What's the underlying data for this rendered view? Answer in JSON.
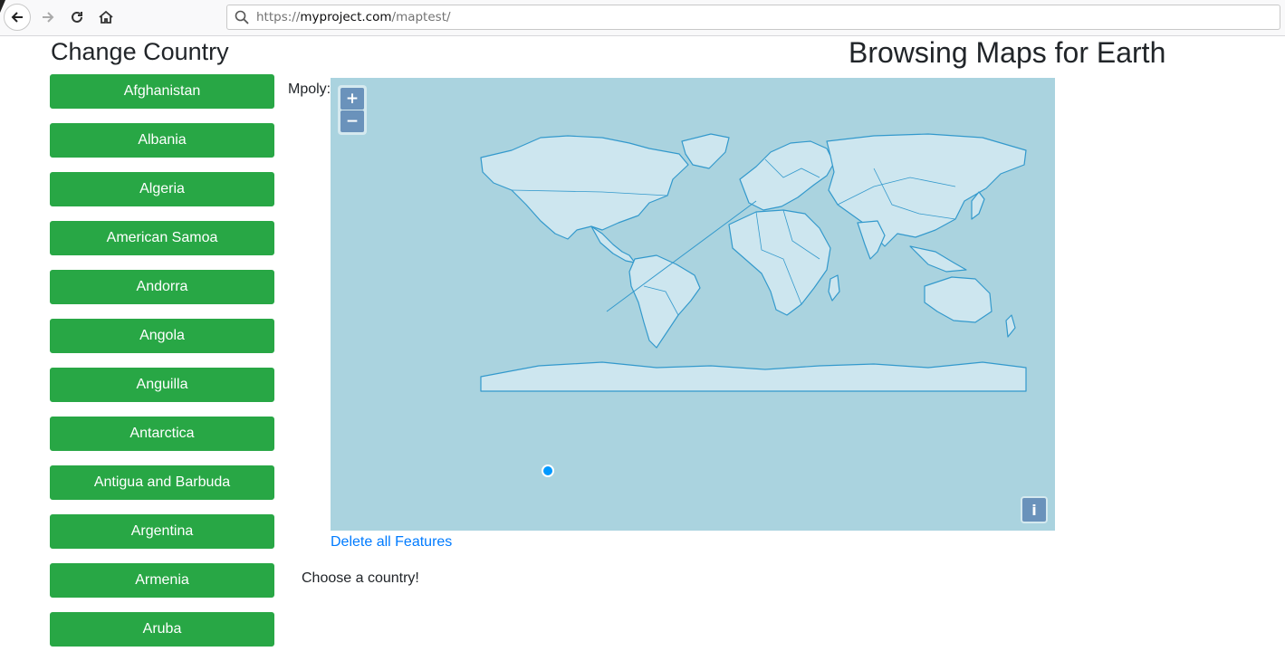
{
  "browser": {
    "url_scheme": "https://",
    "url_host": "myproject.com",
    "url_path": "/maptest/"
  },
  "page": {
    "left_title": "Change Country",
    "right_title": "Browsing Maps for Earth",
    "mpoly_label": "Mpoly:",
    "delete_link": "Delete all Features",
    "status_text": "Choose a country!"
  },
  "countries": [
    "Afghanistan",
    "Albania",
    "Algeria",
    "American Samoa",
    "Andorra",
    "Angola",
    "Anguilla",
    "Antarctica",
    "Antigua and Barbuda",
    "Argentina",
    "Armenia",
    "Aruba"
  ],
  "map": {
    "zoom_in": "+",
    "zoom_out": "−",
    "attribution": "i",
    "ocean_color": "#aad3df",
    "land_color": "#cde6ef",
    "border_color": "#3399cc"
  },
  "colors": {
    "country_button": "#28a745",
    "link": "#007bff"
  }
}
